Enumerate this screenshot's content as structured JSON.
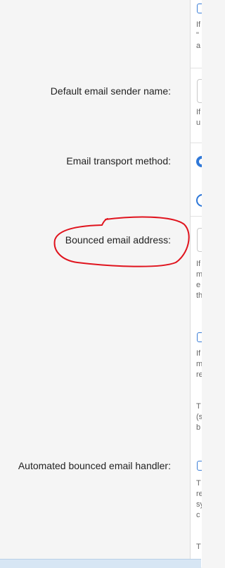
{
  "labels": {
    "default_sender_name": "Default email sender name:",
    "transport_method": "Email transport method:",
    "bounced_email": "Bounced email address:",
    "bounce_handler": "Automated bounced email handler:"
  },
  "hints": {
    "h1": [
      "If",
      "\"",
      "a"
    ],
    "h2": [
      "If",
      "u"
    ],
    "h3": [
      "If",
      "m",
      "e",
      "th"
    ],
    "h4": [
      "If",
      "m",
      "re"
    ],
    "h5": [
      "T",
      "(s",
      "b"
    ],
    "h6": [
      "T",
      "re",
      "sy",
      "c"
    ],
    "h7": [
      "T"
    ]
  },
  "annotation_color": "#e0141e",
  "accent_color": "#2f78d8"
}
